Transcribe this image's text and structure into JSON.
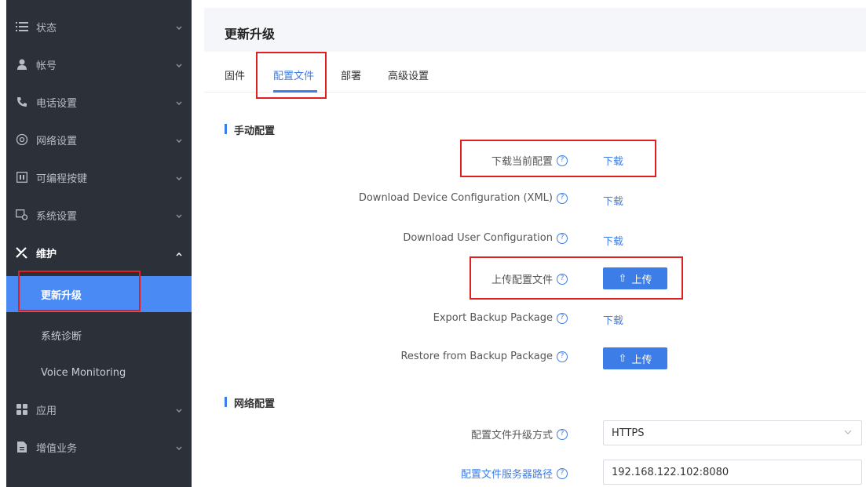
{
  "sidebar": {
    "items": [
      {
        "label": "状态",
        "icon": "list-icon"
      },
      {
        "label": "帐号",
        "icon": "user-icon"
      },
      {
        "label": "电话设置",
        "icon": "phone-icon"
      },
      {
        "label": "网络设置",
        "icon": "network-icon"
      },
      {
        "label": "可编程按键",
        "icon": "keypad-icon"
      },
      {
        "label": "系统设置",
        "icon": "system-icon"
      },
      {
        "label": "维护",
        "icon": "tools-icon"
      }
    ],
    "sub_items": [
      {
        "label": "更新升级"
      },
      {
        "label": "系统诊断"
      },
      {
        "label": "Voice Monitoring"
      }
    ],
    "more_items": [
      {
        "label": "应用",
        "icon": "apps-icon"
      },
      {
        "label": "增值业务",
        "icon": "document-icon"
      }
    ],
    "active_color": "#4a8af4"
  },
  "page": {
    "title": "更新升级",
    "tabs": [
      {
        "label": "固件"
      },
      {
        "label": "配置文件"
      },
      {
        "label": "部署"
      },
      {
        "label": "高级设置"
      }
    ]
  },
  "manual": {
    "section_title": "手动配置",
    "rows": [
      {
        "label": "下载当前配置",
        "action": "下载"
      },
      {
        "label": "Download Device Configuration (XML)",
        "action": "下载"
      },
      {
        "label": "Download User Configuration",
        "action": "下载"
      },
      {
        "label": "上传配置文件",
        "action": "上传"
      },
      {
        "label": "Export Backup Package",
        "action": "下载"
      },
      {
        "label": "Restore from Backup Package",
        "action": "上传"
      }
    ]
  },
  "network": {
    "section_title": "网络配置",
    "upgrade_method_label": "配置文件升级方式",
    "upgrade_method_value": "HTTPS",
    "server_path_label": "配置文件服务器路径",
    "server_path_value": "192.168.122.102:8080"
  },
  "help_glyph": "?",
  "upload_glyph": "⇧",
  "accent_color": "#3d7de8",
  "highlight_color": "#e02020"
}
